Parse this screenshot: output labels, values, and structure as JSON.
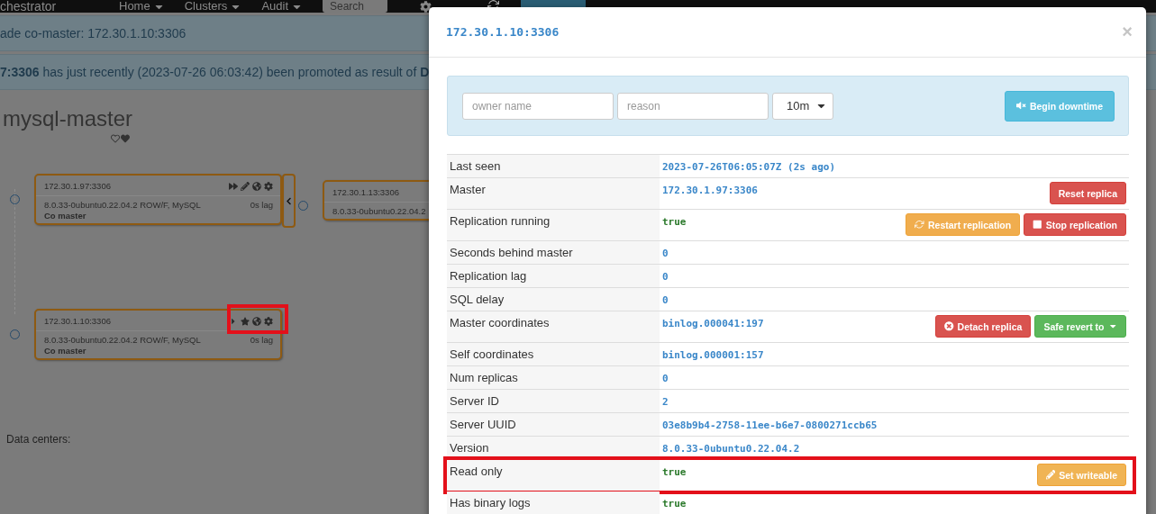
{
  "navbar": {
    "brand": "chestrator",
    "menus": [
      {
        "label": "Home"
      },
      {
        "label": "Clusters"
      },
      {
        "label": "Audit"
      }
    ],
    "search": {
      "placeholder": "Search"
    }
  },
  "alerts": [
    {
      "text": "ade co-master: 172.30.1.10:3306"
    },
    {
      "text": "**7:3306** has just recently (2023-07-26 06:03:42) been promoted as result of **D**"
    }
  ],
  "cluster": {
    "title": "mysql-master",
    "nodes": [
      {
        "host": "172.30.1.97:3306",
        "version": "8.0.33-0ubuntu0.22.04.2 ROW/F, MySQL",
        "lag": "0s lag",
        "role": "Co master",
        "highlight": false,
        "collapse": true
      },
      {
        "host": "172.30.1.13:3306",
        "version": "8.0.33-0ubuntu0.22.04.2",
        "highlight": false
      },
      {
        "host": "172.30.1.10:3306",
        "version": "8.0.33-0ubuntu0.22.04.2 ROW/F, MySQL",
        "lag": "0s lag",
        "role": "Co master",
        "highlight": true,
        "collapse": false
      }
    ],
    "data_centers_label": "Data centers:"
  },
  "modal": {
    "title": "172.30.1.10:3306",
    "close": "×",
    "downtime": {
      "owner_placeholder": "owner name",
      "reason_placeholder": "reason",
      "duration": "10m",
      "button": "Begin downtime"
    },
    "rows": [
      {
        "label": "Last seen",
        "value": "2023-07-26T06:05:07Z (2s ago)",
        "kind": "info",
        "highlight": false
      },
      {
        "label": "Master",
        "value": "172.30.1.97:3306",
        "kind": "info",
        "highlight": false,
        "buttons": [
          {
            "label": "Reset replica",
            "kind": "reset"
          }
        ]
      },
      {
        "label": "Replication running",
        "value": "true",
        "kind": "bool",
        "highlight": false,
        "buttons": [
          {
            "label": "Restart replication",
            "kind": "restart"
          },
          {
            "label": "Stop replication",
            "kind": "stop"
          }
        ]
      },
      {
        "label": "Seconds behind master",
        "value": "0",
        "kind": "info",
        "highlight": false
      },
      {
        "label": "Replication lag",
        "value": "0",
        "kind": "info",
        "highlight": false
      },
      {
        "label": "SQL delay",
        "value": "0",
        "kind": "info",
        "highlight": false
      },
      {
        "label": "Master coordinates",
        "value": "binlog.000041:197",
        "kind": "info",
        "highlight": false,
        "buttons": [
          {
            "label": "Detach replica",
            "kind": "detach"
          },
          {
            "label": "Safe revert to",
            "kind": "revert"
          }
        ]
      },
      {
        "label": "Self coordinates",
        "value": "binlog.000001:157",
        "kind": "info",
        "highlight": false
      },
      {
        "label": "Num replicas",
        "value": "0",
        "kind": "info",
        "highlight": false
      },
      {
        "label": "Server ID",
        "value": "2",
        "kind": "info",
        "highlight": false
      },
      {
        "label": "Server UUID",
        "value": "03e8b9b4-2758-11ee-b6e7-0800271ccb65",
        "kind": "info",
        "highlight": false
      },
      {
        "label": "Version",
        "value": "8.0.33-0ubuntu0.22.04.2",
        "kind": "info",
        "highlight": false
      },
      {
        "label": "Read only",
        "value": "true",
        "kind": "bool",
        "highlight": true,
        "buttons": [
          {
            "label": "Set writeable",
            "kind": "writeable"
          }
        ]
      },
      {
        "label": "Has binary logs",
        "value": "true",
        "kind": "bool",
        "highlight": false
      }
    ]
  }
}
